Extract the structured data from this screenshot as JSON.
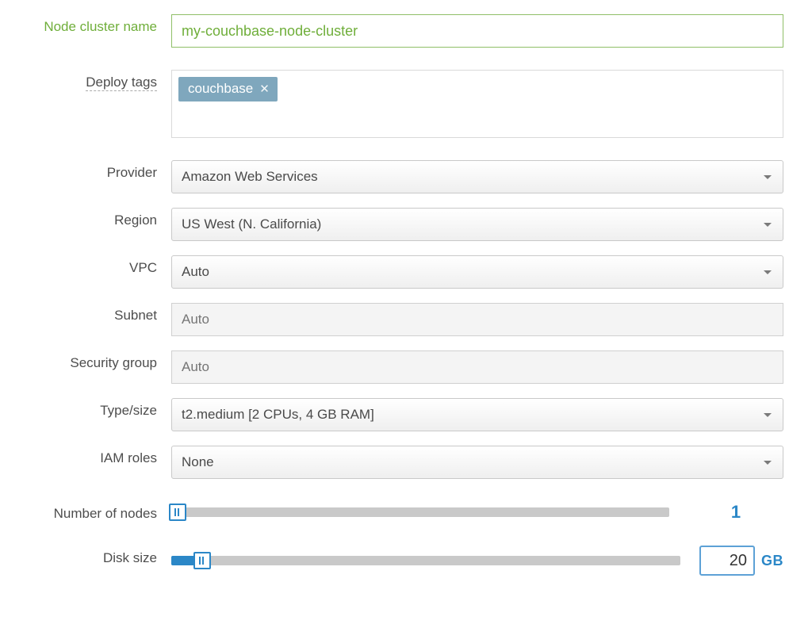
{
  "labels": {
    "name": "Node cluster name",
    "tags": "Deploy tags",
    "provider": "Provider",
    "region": "Region",
    "vpc": "VPC",
    "subnet": "Subnet",
    "sg": "Security group",
    "type": "Type/size",
    "iam": "IAM roles",
    "nodes": "Number of nodes",
    "disk": "Disk size"
  },
  "name_value": "my-couchbase-node-cluster",
  "tags": [
    {
      "label": "couchbase"
    }
  ],
  "provider": "Amazon Web Services",
  "region": "US West (N. California)",
  "vpc": "Auto",
  "subnet_placeholder": "Auto",
  "sg_placeholder": "Auto",
  "type": "t2.medium [2 CPUs, 4 GB RAM]",
  "iam": "None",
  "nodes_value": "1",
  "disk_value": "20",
  "disk_unit": "GB",
  "slider": {
    "nodes_percent": "1.2%",
    "disk_percent": "6%"
  }
}
